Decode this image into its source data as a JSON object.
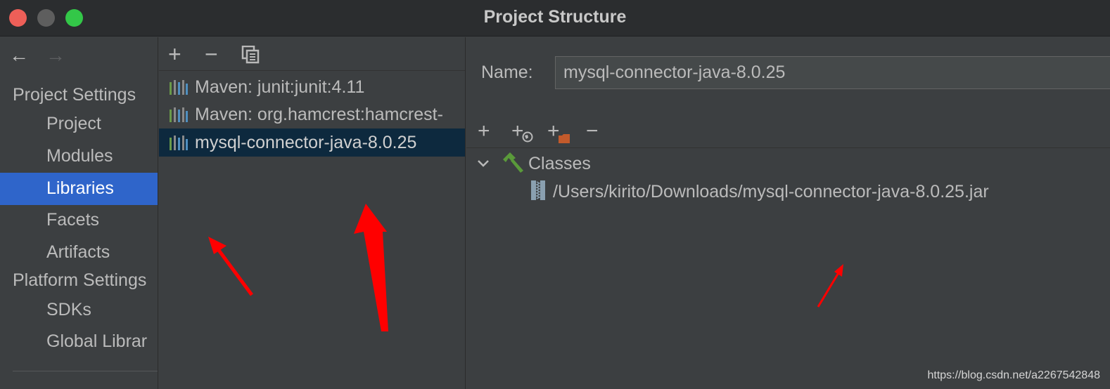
{
  "window": {
    "title": "Project Structure"
  },
  "sidebar": {
    "back_arrow": "←",
    "forward_arrow": "→",
    "project_settings_header": "Project Settings",
    "project_items": [
      "Project",
      "Modules",
      "Libraries",
      "Facets",
      "Artifacts"
    ],
    "platform_settings_header": "Platform Settings",
    "platform_items": [
      "SDKs",
      "Global Librar"
    ],
    "selected": "Libraries"
  },
  "libraries": {
    "toolbar": {
      "add": "+",
      "remove": "−"
    },
    "items": [
      "Maven: junit:junit:4.11",
      "Maven: org.hamcrest:hamcrest-",
      "mysql-connector-java-8.0.25"
    ],
    "selected": "mysql-connector-java-8.0.25"
  },
  "detail": {
    "name_label": "Name:",
    "name_value": "mysql-connector-java-8.0.25",
    "toolbar": {
      "add": "+",
      "add_url": "+",
      "add_folder": "+",
      "remove": "−"
    },
    "tree": {
      "classes_label": "Classes",
      "jar_path": "/Users/kirito/Downloads/mysql-connector-java-8.0.25.jar"
    }
  },
  "watermark": "https://blog.csdn.net/a2267542848",
  "colors": {
    "selection_blue": "#2f65ca",
    "list_selection": "#0d293e",
    "annotation_red": "#ff0000"
  }
}
